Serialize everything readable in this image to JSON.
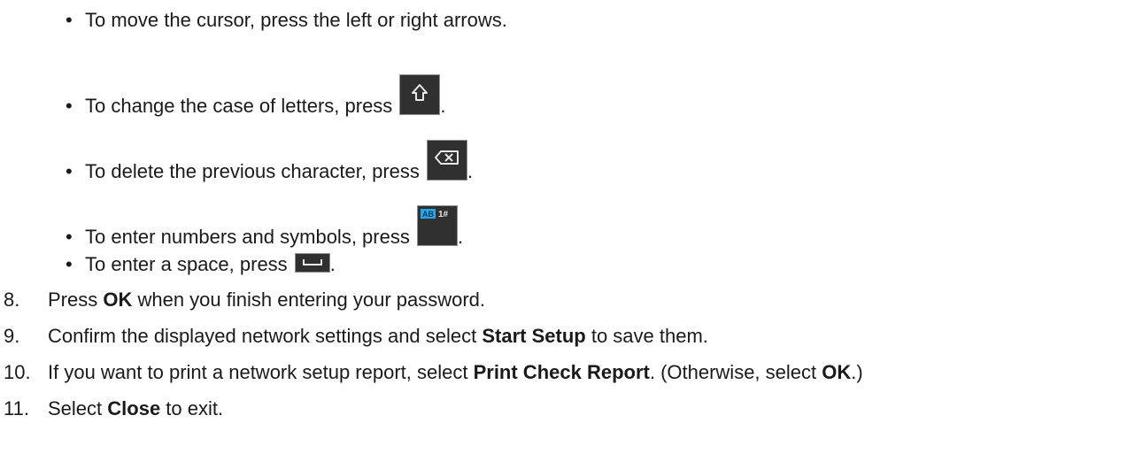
{
  "bullets": [
    {
      "text": "To move the cursor, press the left or right arrows."
    },
    {
      "text": "To change the case of letters, press ",
      "after": ".",
      "icon": "shift-key-icon"
    },
    {
      "text": "To delete the previous character, press ",
      "after": ".",
      "icon": "backspace-key-icon"
    },
    {
      "text": "To enter numbers and symbols, press ",
      "after": ".",
      "icon": "ab-123-key-icon",
      "icon_text": {
        "ab": "AB",
        "num": "1#"
      }
    },
    {
      "text": "To enter a space, press ",
      "after": ".",
      "icon": "space-key-icon"
    }
  ],
  "bullet_char": "•",
  "steps": [
    {
      "num": "8.",
      "before": "Press ",
      "bold": "OK",
      "after": " when you finish entering your password."
    },
    {
      "num": "9.",
      "before": "Confirm the displayed network settings and select ",
      "bold": "Start Setup",
      "after": " to save them."
    },
    {
      "num": "10.",
      "before": "If you want to print a network setup report, select ",
      "bold": "Print Check Report",
      "mid": ". (Otherwise, select ",
      "bold2": "OK",
      "after": ".)"
    },
    {
      "num": "11.",
      "before": "Select ",
      "bold": "Close",
      "after": " to exit."
    }
  ],
  "colors": {
    "text": "#1a1a1a",
    "key_bg": "#303030",
    "key_border": "#8e8e8e",
    "key_glyph": "#e8e8e8",
    "ab_badge": "#29a6e6"
  }
}
